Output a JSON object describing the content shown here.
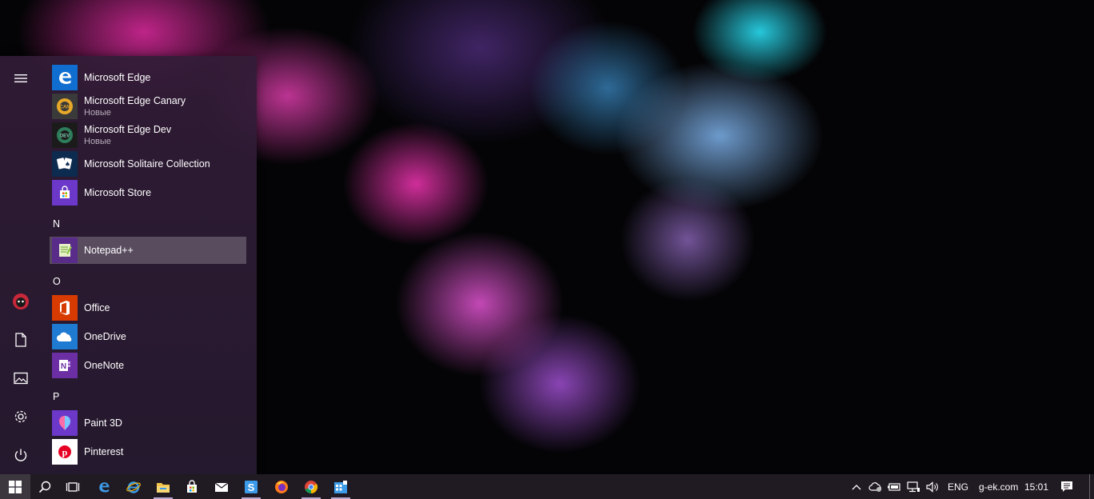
{
  "start_menu": {
    "apps": [
      {
        "name": "Microsoft Edge",
        "sub": "",
        "icon": "edge-icon",
        "color": "#0f6ecf"
      },
      {
        "name": "Microsoft Edge Canary",
        "sub": "Новые",
        "icon": "edge-canary-icon",
        "color": "#3a3a3a"
      },
      {
        "name": "Microsoft Edge Dev",
        "sub": "Новые",
        "icon": "edge-dev-icon",
        "color": "#1b1b1b"
      },
      {
        "name": "Microsoft Solitaire Collection",
        "sub": "",
        "icon": "solitaire-icon",
        "color": "#0d2a4f"
      },
      {
        "name": "Microsoft Store",
        "sub": "",
        "icon": "store-icon",
        "color": "#6b38c9"
      },
      {
        "name": "Notepad++",
        "sub": "",
        "icon": "notepadpp-icon",
        "color": "#5a2c8a"
      },
      {
        "name": "Office",
        "sub": "",
        "icon": "office-icon",
        "color": "#d83b01"
      },
      {
        "name": "OneDrive",
        "sub": "",
        "icon": "onedrive-icon",
        "color": "#1f7ad1"
      },
      {
        "name": "OneNote",
        "sub": "",
        "icon": "onenote-icon",
        "color": "#6b2fa3"
      },
      {
        "name": "Paint 3D",
        "sub": "",
        "icon": "paint3d-icon",
        "color": "#6b38c9"
      },
      {
        "name": "Pinterest",
        "sub": "",
        "icon": "pinterest-icon",
        "color": "#ffffff"
      }
    ],
    "letters": [
      "N",
      "O",
      "P"
    ],
    "selected_app": "Notepad++"
  },
  "taskbar": {
    "language": "ENG",
    "site": "g-ek.com",
    "time": "15:01"
  }
}
